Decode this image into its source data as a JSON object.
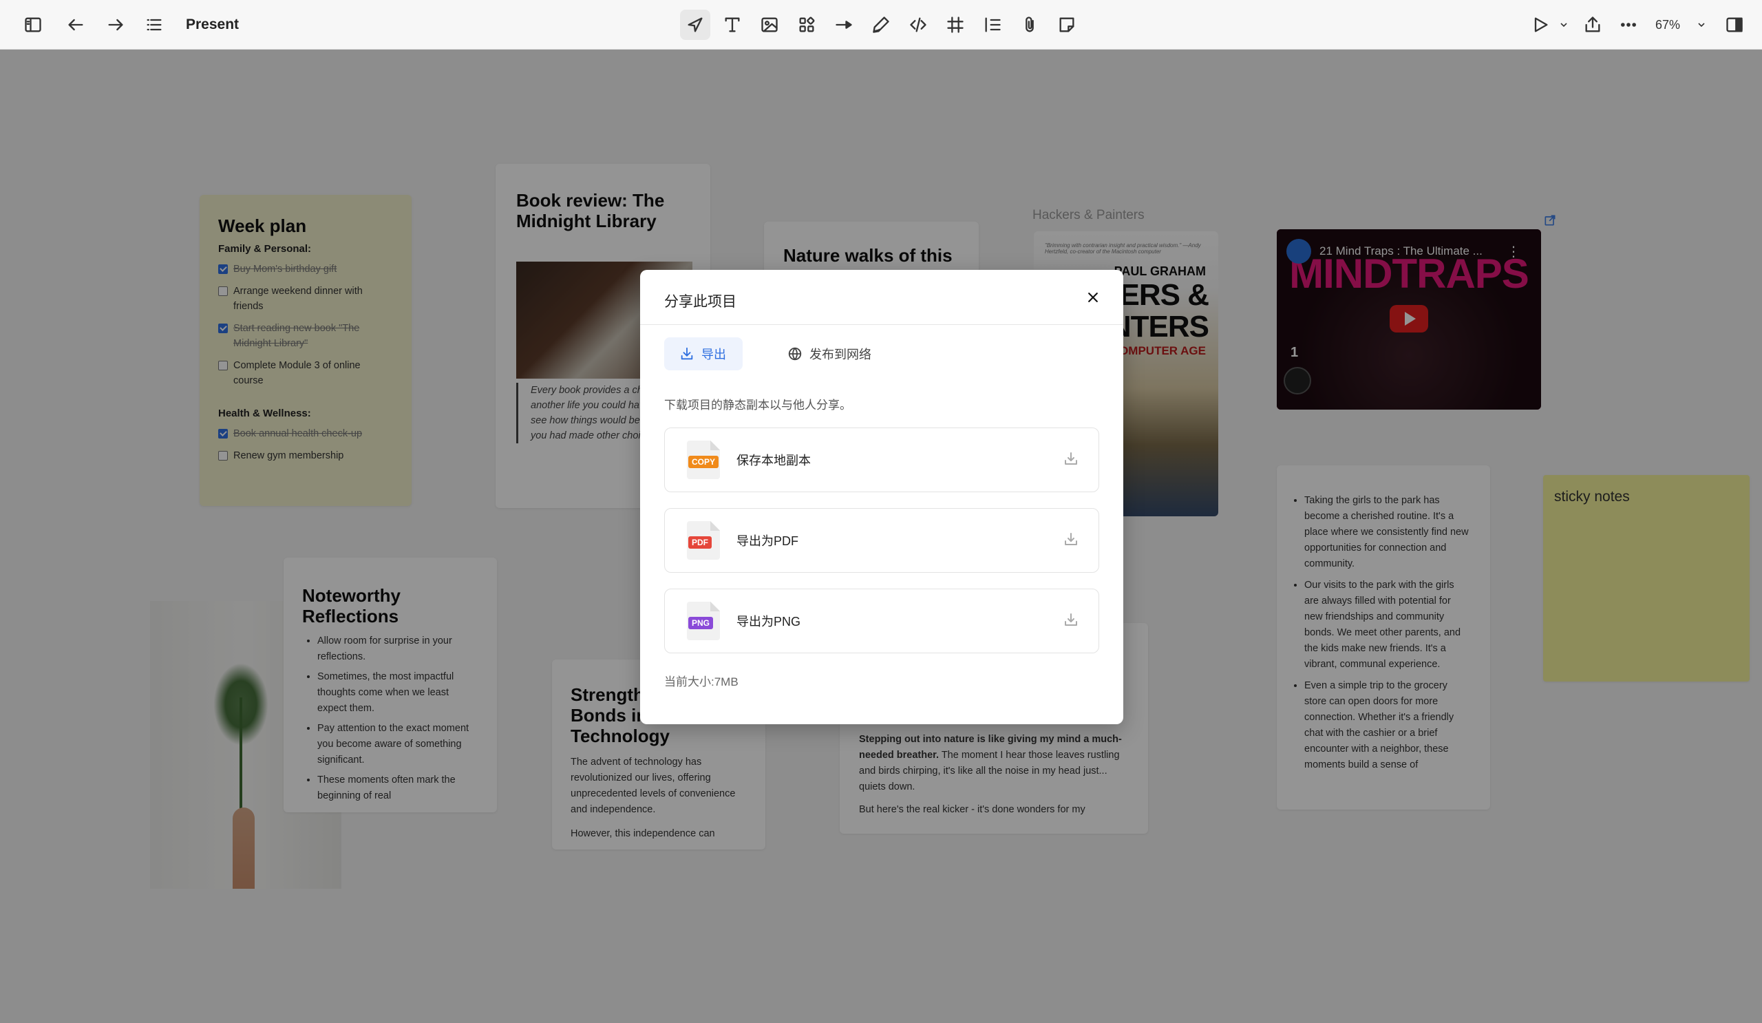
{
  "toolbar": {
    "title": "Present",
    "zoom": "67%"
  },
  "cards": {
    "week_plan": {
      "title": "Week plan",
      "section1": "Family & Personal:",
      "items1": [
        {
          "text": "Buy Mom's birthday gift",
          "done": true
        },
        {
          "text": "Arrange weekend dinner with friends",
          "done": false
        },
        {
          "text": "Start reading new book \"The Midnight Library\"",
          "done": true
        },
        {
          "text": "Complete Module 3 of online course",
          "done": false
        }
      ],
      "section2": "Health & Wellness:",
      "items2": [
        {
          "text": "Book annual health check-up",
          "done": true
        },
        {
          "text": "Renew gym membership",
          "done": false
        }
      ]
    },
    "book_review": {
      "title": "Book review: The Midnight Library",
      "quote": "Every book provides a chance to try another life you could have lived. To see how things would be different if you had made other choices..."
    },
    "nature_top": {
      "title": "Nature walks of this"
    },
    "hackers": {
      "label": "Hackers & Painters",
      "tiny": "\"Brimming with contrarian insight and practical wisdom.\" —Andy Hertzfeld, co-creator of the Macintosh computer",
      "author": "PAUL GRAHAM",
      "title": "CKERS & AINTERS",
      "subtitle": "THE COMPUTER AGE"
    },
    "video": {
      "title": "21 Mind Traps : The Ultimate ...",
      "banner": "MINDTRAPS",
      "number": "1"
    },
    "park": {
      "items": [
        "Taking the girls to the park has become a cherished routine. It's a place where we consistently find new opportunities for connection and community.",
        "Our visits to the park with the girls are always filled with potential for new friendships and community bonds. We meet other parents, and the kids make new friends. It's a vibrant, communal experience.",
        "Even a simple trip to the grocery store can open doors for more connection. Whether it's a friendly chat with the cashier or a brief encounter with a neighbor, these moments build a sense of"
      ]
    },
    "sticky": {
      "text": "sticky notes"
    },
    "reflections": {
      "title": "Noteworthy Reflections",
      "items": [
        "Allow room for surprise in your reflections.",
        "Sometimes, the most impactful thoughts come when we least expect them.",
        "Pay attention to the exact moment you become aware of something significant.",
        "These moments often mark the beginning of real"
      ]
    },
    "tech": {
      "title": "Strengthening Bonds in Technology",
      "p1": "The advent of technology has revolutionized our lives, offering unprecedented levels of convenience and independence.",
      "p2": "However, this independence can"
    },
    "nature_bottom": {
      "bold": "Stepping out into nature is like giving my mind a much-needed breather.",
      "rest": " The moment I hear those leaves rustling and birds chirping, it's like all the noise in my head just... quiets down.",
      "p2": "But here's the real kicker - it's done wonders for my"
    }
  },
  "modal": {
    "title": "分享此项目",
    "tabs": {
      "export": "导出",
      "publish": "发布到网络"
    },
    "description": "下载项目的静态副本以与他人分享。",
    "options": [
      {
        "tag": "COPY",
        "label": "保存本地副本"
      },
      {
        "tag": "PDF",
        "label": "导出为PDF"
      },
      {
        "tag": "PNG",
        "label": "导出为PNG"
      }
    ],
    "size": "当前大小:7MB"
  }
}
